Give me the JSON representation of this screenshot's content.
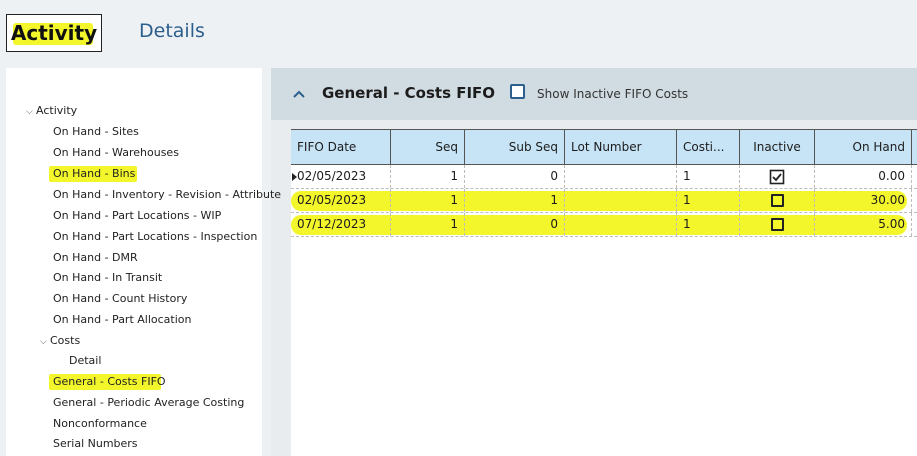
{
  "tabs": {
    "activity": "Activity",
    "details": "Details"
  },
  "tree": {
    "root": "Activity",
    "items": [
      "On Hand - Sites",
      "On Hand - Warehouses",
      "On Hand - Bins",
      "On Hand - Inventory - Revision - Attribute",
      "On Hand - Part Locations - WIP",
      "On Hand - Part Locations - Inspection",
      "On Hand - DMR",
      "On Hand - In Transit",
      "On Hand - Count History",
      "On Hand - Part Allocation"
    ],
    "costs": "Costs",
    "detail": "Detail",
    "more": [
      "General - Costs FIFO",
      "General - Periodic Average Costing",
      "Nonconformance",
      "Serial Numbers"
    ]
  },
  "panel": {
    "title": "General - Costs FIFO",
    "show_inactive": "Show Inactive FIFO Costs"
  },
  "grid": {
    "columns": [
      "FIFO Date",
      "Seq",
      "Sub Seq",
      "Lot Number",
      "Costi...",
      "Inactive",
      "On Hand"
    ],
    "rows": [
      {
        "date": "02/05/2023",
        "seq": "1",
        "subseq": "0",
        "lot": "",
        "costing": "1",
        "inactive": true,
        "onhand": "0.00"
      },
      {
        "date": "02/05/2023",
        "seq": "1",
        "subseq": "1",
        "lot": "",
        "costing": "1",
        "inactive": false,
        "onhand": "30.00"
      },
      {
        "date": "07/12/2023",
        "seq": "1",
        "subseq": "0",
        "lot": "",
        "costing": "1",
        "inactive": false,
        "onhand": "5.00"
      }
    ]
  },
  "colors": {
    "highlight": "#f3f62a",
    "accent": "#2d5f8d",
    "grid_header": "#c7e4f6"
  }
}
